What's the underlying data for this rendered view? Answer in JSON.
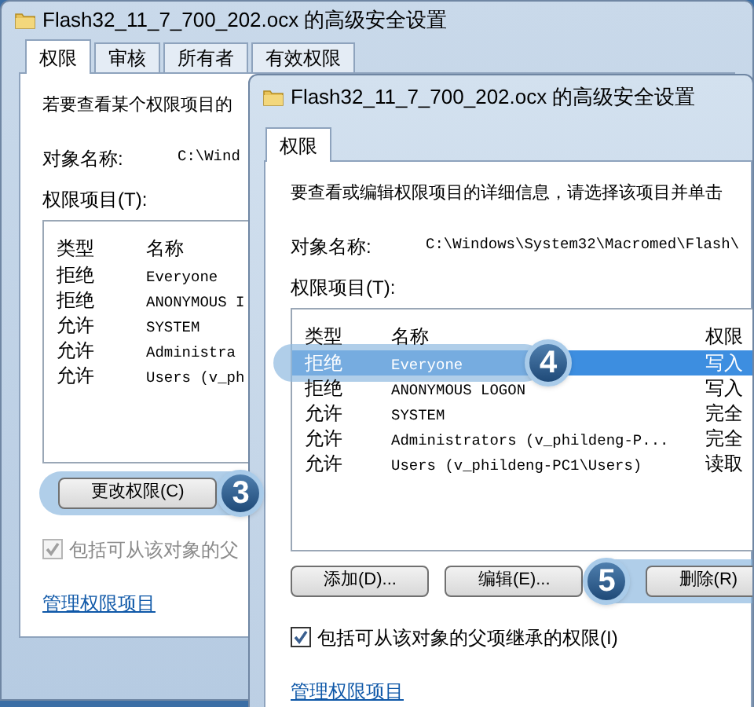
{
  "back_window": {
    "title": "Flash32_11_7_700_202.ocx 的高级安全设置",
    "tabs": [
      {
        "label": "权限",
        "selected": true
      },
      {
        "label": "审核",
        "selected": false
      },
      {
        "label": "所有者",
        "selected": false
      },
      {
        "label": "有效权限",
        "selected": false
      }
    ],
    "description": "若要查看某个权限项目的",
    "object_name_label": "对象名称:",
    "object_name": "C:\\Wind",
    "entries_label": "权限项目(T):",
    "columns": [
      "类型",
      "名称"
    ],
    "rows": [
      {
        "type": "拒绝",
        "name": "Everyone"
      },
      {
        "type": "拒绝",
        "name": "ANONYMOUS I"
      },
      {
        "type": "允许",
        "name": "SYSTEM"
      },
      {
        "type": "允许",
        "name": "Administra"
      },
      {
        "type": "允许",
        "name": "Users (v_ph"
      }
    ],
    "buttons": [
      {
        "label": "更改权限(C)",
        "callout": "3"
      }
    ],
    "inherit_checkbox": {
      "label": "包括可从该对象的父",
      "checked": true,
      "disabled": true
    },
    "link": "管理权限项目"
  },
  "front_window": {
    "title": "Flash32_11_7_700_202.ocx 的高级安全设置",
    "tabs": [
      {
        "label": "权限",
        "selected": true
      }
    ],
    "description": "要查看或编辑权限项目的详细信息，请选择该项目并单击",
    "object_name_label": "对象名称:",
    "object_name": "C:\\Windows\\System32\\Macromed\\Flash\\",
    "entries_label": "权限项目(T):",
    "columns": [
      "类型",
      "名称",
      "权限"
    ],
    "rows": [
      {
        "type": "拒绝",
        "name": "Everyone",
        "permission": "写入",
        "selected": true,
        "callout": "4"
      },
      {
        "type": "拒绝",
        "name": "ANONYMOUS LOGON",
        "permission": "写入",
        "selected": false
      },
      {
        "type": "允许",
        "name": "SYSTEM",
        "permission": "完全",
        "selected": false
      },
      {
        "type": "允许",
        "name": "Administrators (v_phildeng-P...",
        "permission": "完全",
        "selected": false
      },
      {
        "type": "允许",
        "name": "Users (v_phildeng-PC1\\Users)",
        "permission": "读取",
        "selected": false
      }
    ],
    "buttons": [
      {
        "label": "添加(D)..."
      },
      {
        "label": "编辑(E)..."
      },
      {
        "label": "删除(R)",
        "callout": "5"
      }
    ],
    "inherit_checkbox": {
      "label": "包括可从该对象的父项继承的权限(I)",
      "checked": true,
      "disabled": false
    },
    "link": "管理权限项目"
  }
}
